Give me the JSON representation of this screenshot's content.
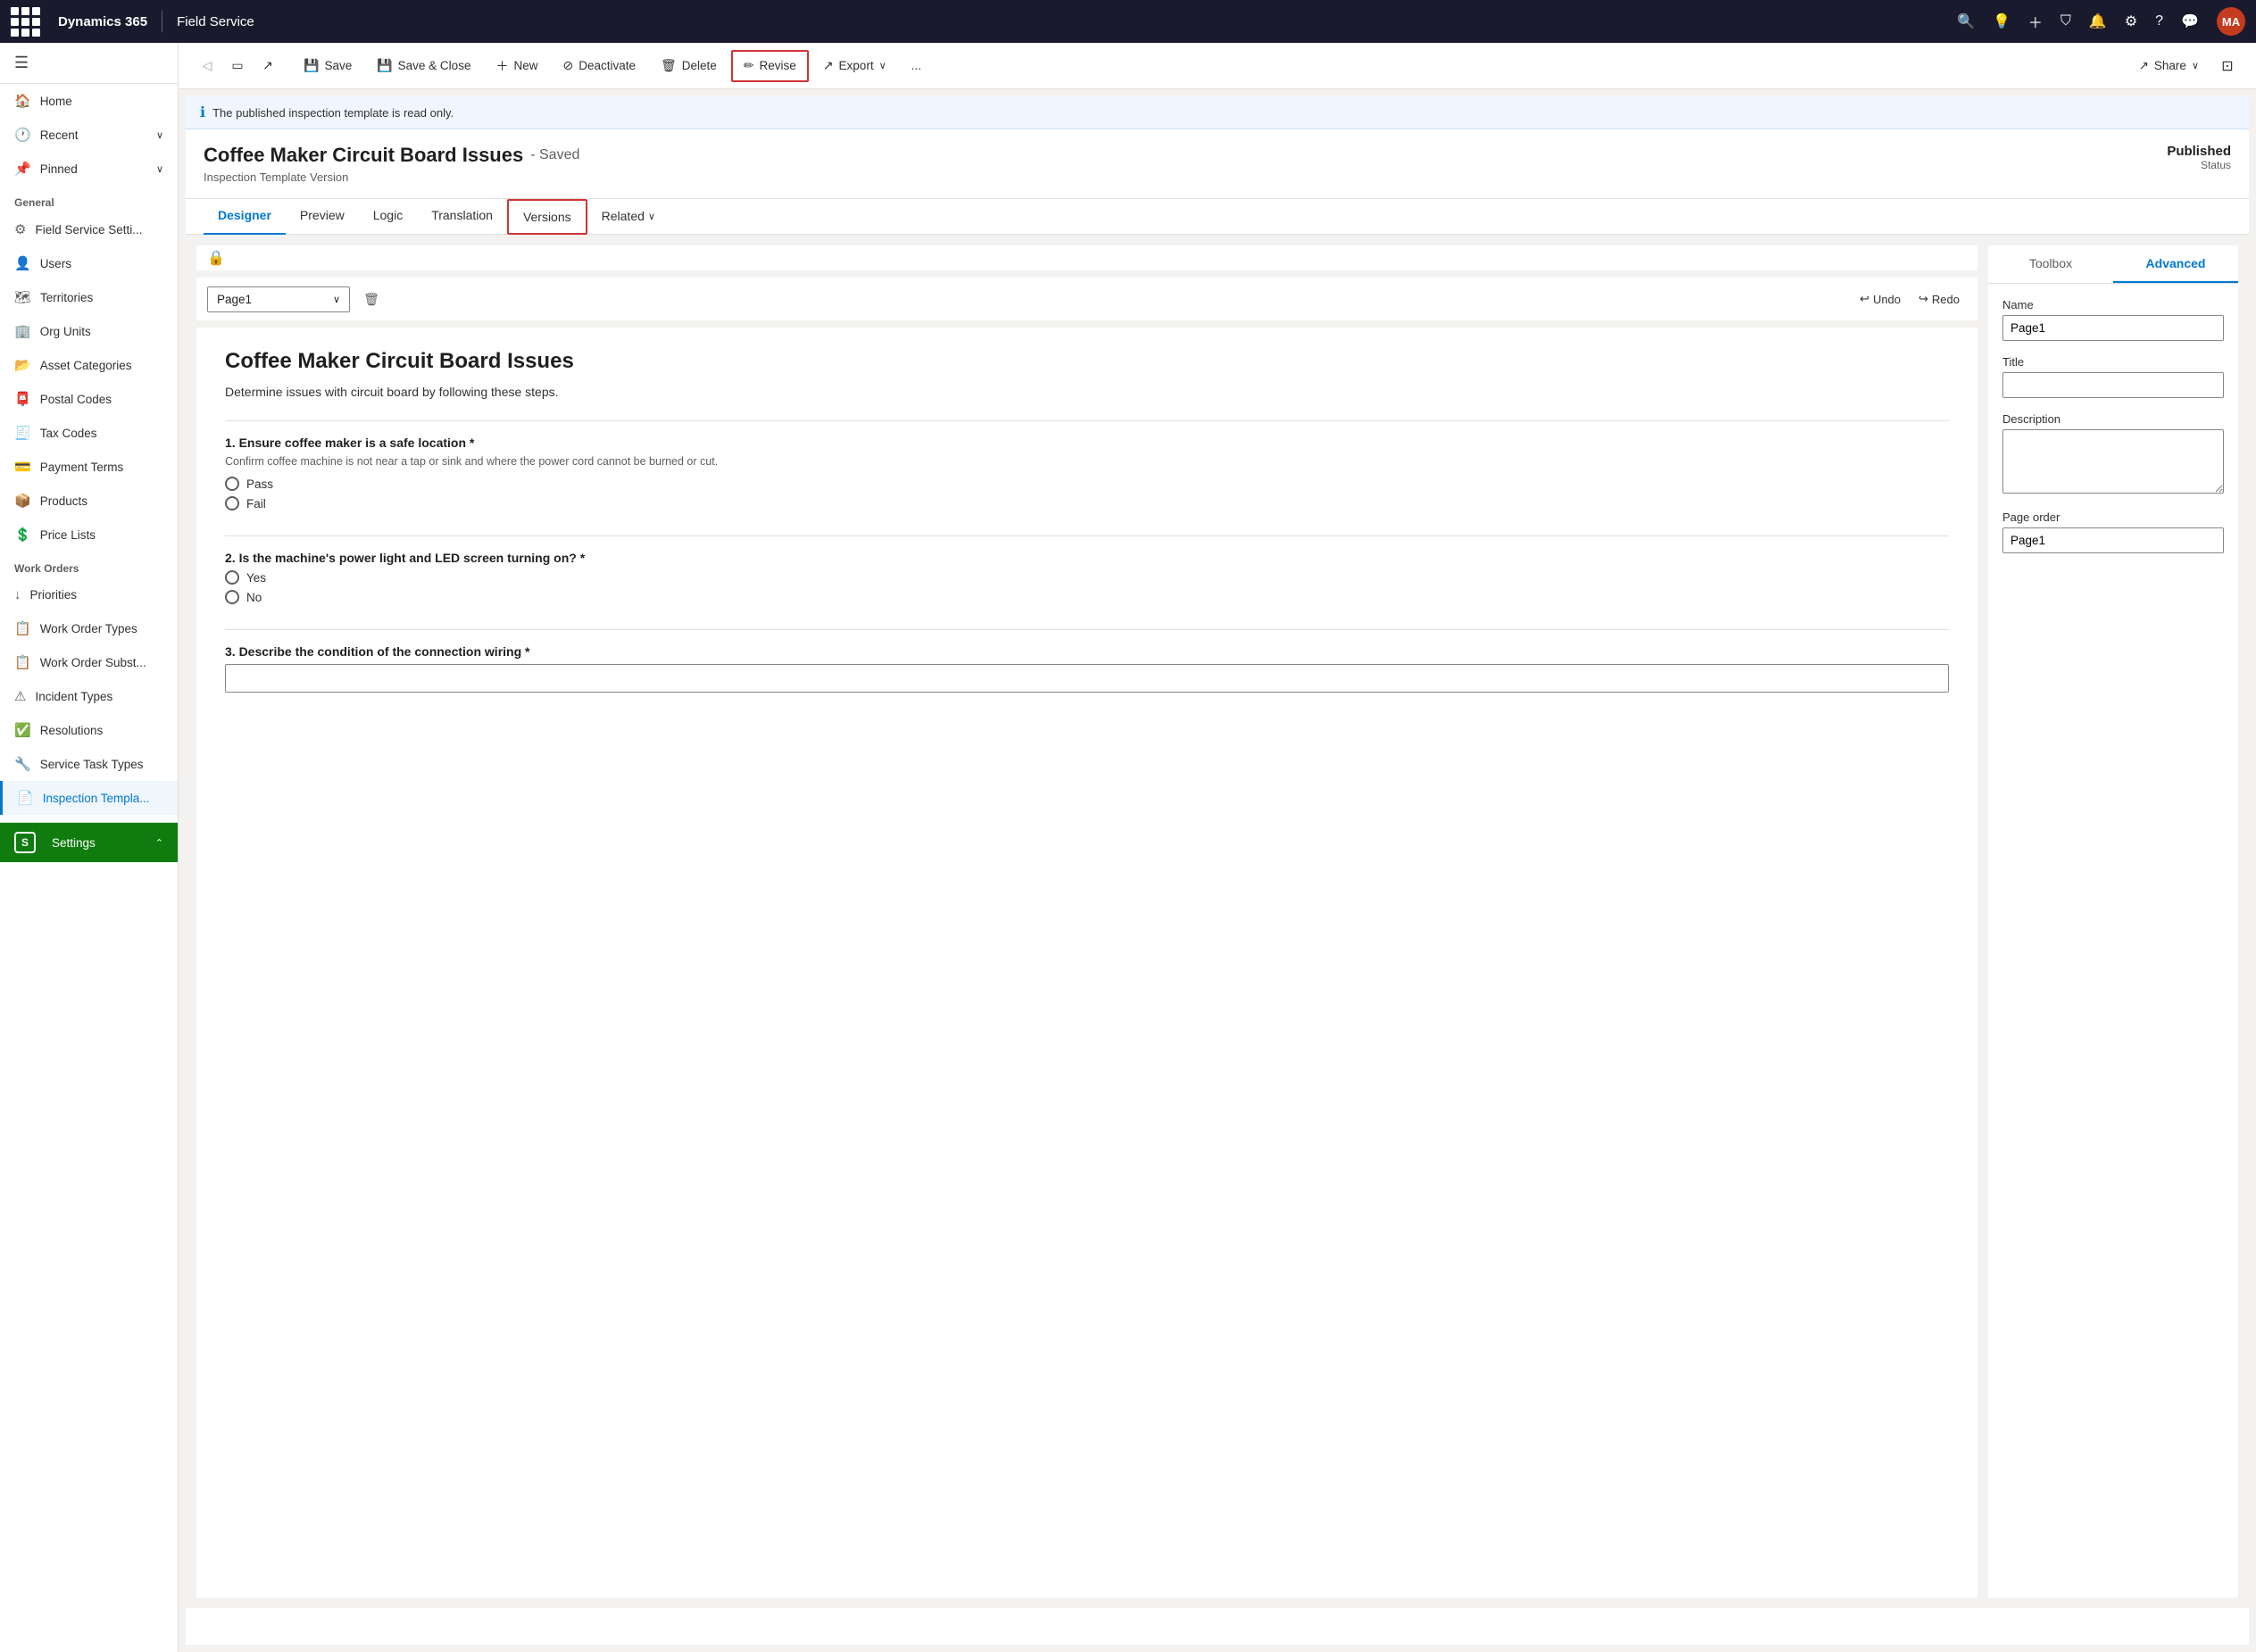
{
  "topnav": {
    "brand": "Dynamics 365",
    "separator": "|",
    "app": "Field Service",
    "avatar_initials": "MA",
    "icons": [
      "search",
      "lightbulb",
      "plus",
      "filter",
      "bell",
      "settings",
      "help",
      "chat"
    ]
  },
  "sidebar": {
    "general_section": "General",
    "work_orders_section": "Work Orders",
    "items_general": [
      {
        "id": "home",
        "label": "Home",
        "icon": "🏠"
      },
      {
        "id": "recent",
        "label": "Recent",
        "icon": "🕐",
        "chevron": true
      },
      {
        "id": "pinned",
        "label": "Pinned",
        "icon": "📌",
        "chevron": true
      }
    ],
    "items_config": [
      {
        "id": "field-service-settings",
        "label": "Field Service Setti...",
        "icon": "⚙"
      },
      {
        "id": "users",
        "label": "Users",
        "icon": "👤"
      },
      {
        "id": "territories",
        "label": "Territories",
        "icon": "🗺"
      },
      {
        "id": "org-units",
        "label": "Org Units",
        "icon": "🏢"
      },
      {
        "id": "asset-categories",
        "label": "Asset Categories",
        "icon": "📂"
      },
      {
        "id": "postal-codes",
        "label": "Postal Codes",
        "icon": "📮"
      },
      {
        "id": "tax-codes",
        "label": "Tax Codes",
        "icon": "🧾"
      },
      {
        "id": "payment-terms",
        "label": "Payment Terms",
        "icon": "💳"
      },
      {
        "id": "products",
        "label": "Products",
        "icon": "📦"
      },
      {
        "id": "price-lists",
        "label": "Price Lists",
        "icon": "💲"
      }
    ],
    "items_workorders": [
      {
        "id": "priorities",
        "label": "Priorities",
        "icon": "↓"
      },
      {
        "id": "work-order-types",
        "label": "Work Order Types",
        "icon": "📋"
      },
      {
        "id": "work-order-subst",
        "label": "Work Order Subst...",
        "icon": "📋"
      },
      {
        "id": "incident-types",
        "label": "Incident Types",
        "icon": "⚠"
      },
      {
        "id": "resolutions",
        "label": "Resolutions",
        "icon": "✅"
      },
      {
        "id": "service-task-types",
        "label": "Service Task Types",
        "icon": "🔧"
      },
      {
        "id": "inspection-templates",
        "label": "Inspection Templa...",
        "icon": "📄",
        "active": true
      }
    ],
    "settings": {
      "label": "Settings",
      "icon": "S"
    }
  },
  "commandbar": {
    "save_label": "Save",
    "save_close_label": "Save & Close",
    "new_label": "New",
    "deactivate_label": "Deactivate",
    "delete_label": "Delete",
    "revise_label": "Revise",
    "export_label": "Export",
    "share_label": "Share",
    "more_icon": "..."
  },
  "infobanner": {
    "message": "The published inspection template is read only."
  },
  "record": {
    "title": "Coffee Maker Circuit Board Issues",
    "saved_indicator": "- Saved",
    "subtitle": "Inspection Template Version",
    "status_value": "Published",
    "status_label": "Status"
  },
  "tabs": [
    {
      "id": "designer",
      "label": "Designer",
      "active": true
    },
    {
      "id": "preview",
      "label": "Preview"
    },
    {
      "id": "logic",
      "label": "Logic"
    },
    {
      "id": "translation",
      "label": "Translation"
    },
    {
      "id": "versions",
      "label": "Versions",
      "outlined": true
    },
    {
      "id": "related",
      "label": "Related",
      "dropdown": true
    }
  ],
  "designer": {
    "lock_icon": "🔒",
    "page_select_value": "Page1",
    "undo_label": "Undo",
    "redo_label": "Redo",
    "canvas": {
      "title": "Coffee Maker Circuit Board Issues",
      "description": "Determine issues with circuit board by following these steps.",
      "questions": [
        {
          "id": "q1",
          "label": "1. Ensure coffee maker is a safe location *",
          "hint": "Confirm coffee machine is not near a tap or sink and where the power cord cannot be burned or cut.",
          "type": "radio",
          "options": [
            "Pass",
            "Fail"
          ]
        },
        {
          "id": "q2",
          "label": "2. Is the machine's power light and LED screen turning on? *",
          "hint": "",
          "type": "radio",
          "options": [
            "Yes",
            "No"
          ]
        },
        {
          "id": "q3",
          "label": "3. Describe the condition of the connection wiring *",
          "hint": "",
          "type": "text",
          "options": []
        }
      ]
    }
  },
  "properties": {
    "toolbox_tab": "Toolbox",
    "advanced_tab": "Advanced",
    "name_label": "Name",
    "name_value": "Page1",
    "title_label": "Title",
    "title_value": "",
    "description_label": "Description",
    "description_value": "",
    "page_order_label": "Page order",
    "page_order_value": "Page1"
  }
}
